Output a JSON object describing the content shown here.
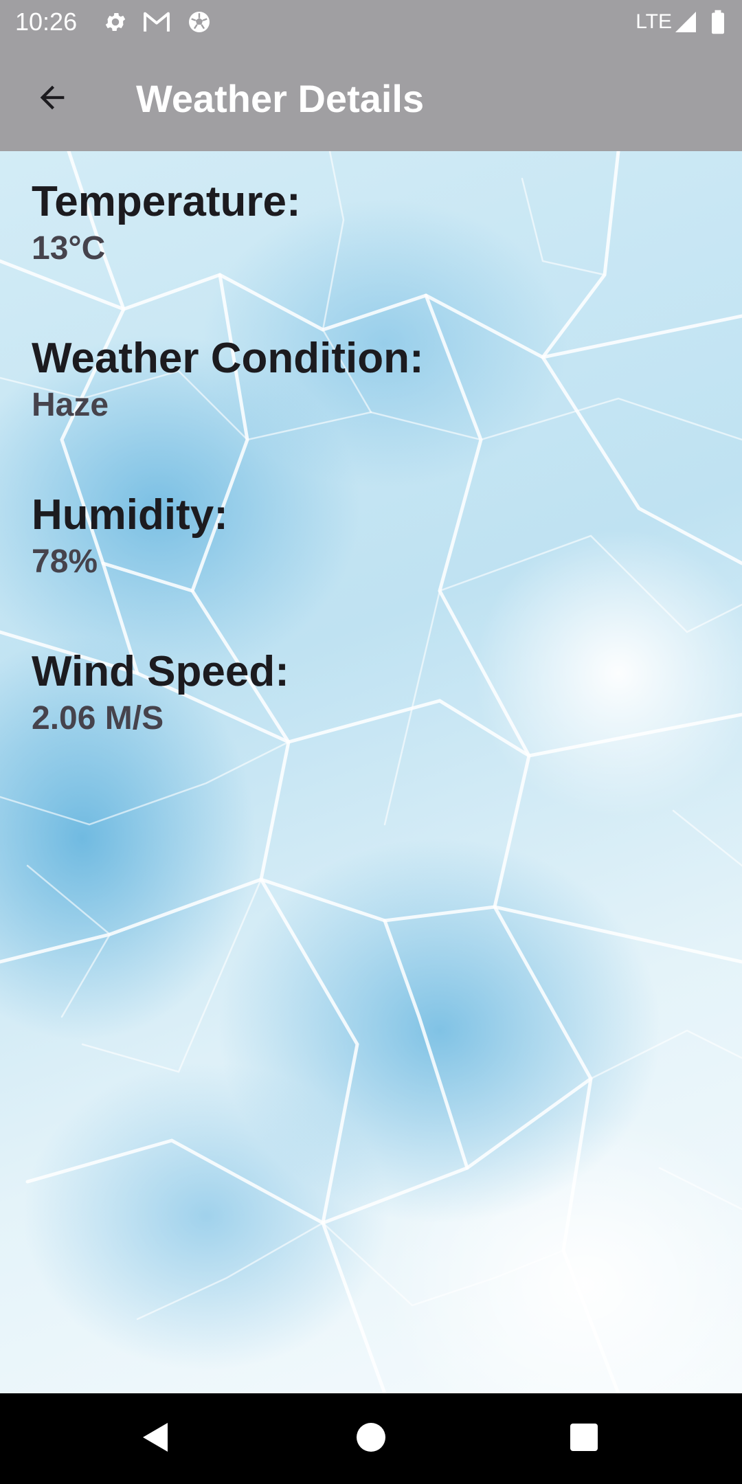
{
  "status_bar": {
    "time": "10:26",
    "network": "LTE",
    "icons": [
      "settings-icon",
      "gmail-icon",
      "soccer-ball-icon",
      "signal-icon",
      "battery-icon"
    ]
  },
  "app_bar": {
    "title": "Weather Details",
    "back_icon": "arrow-back-icon",
    "background_color": "#a09fa2"
  },
  "details": [
    {
      "label": "Temperature:",
      "value": "13°C"
    },
    {
      "label": "Weather Condition:",
      "value": "Haze"
    },
    {
      "label": "Humidity:",
      "value": "78%"
    },
    {
      "label": "Wind Speed:",
      "value": "2.06 M/S"
    }
  ],
  "nav_bar": {
    "icons": [
      "back-triangle-icon",
      "home-circle-icon",
      "recents-square-icon"
    ]
  }
}
